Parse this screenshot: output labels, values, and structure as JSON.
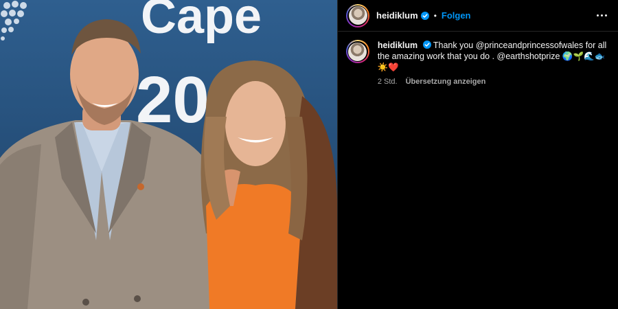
{
  "photo": {
    "backdrop_text_line1": "Cape",
    "backdrop_text_line2": "2024",
    "alt": "Heidi Klum and Prince William"
  },
  "post": {
    "username": "heidiklum",
    "verified": true,
    "follow_label": "Folgen",
    "separator": "•",
    "more_icon": "more-horizontal-icon",
    "caption": {
      "username": "heidiklum",
      "text": "Thank you @princeandprincessofwales for all the amazing work that you do . @earthshotprize",
      "emojis": "🌍🌱🌊🐟☀️❤️"
    },
    "time": "2 Std.",
    "translate_label": "Übersetzung anzeigen"
  },
  "colors": {
    "accent": "#0095f6",
    "background": "#000000",
    "text": "#f5f5f5",
    "secondary_text": "#a8a8a8"
  }
}
